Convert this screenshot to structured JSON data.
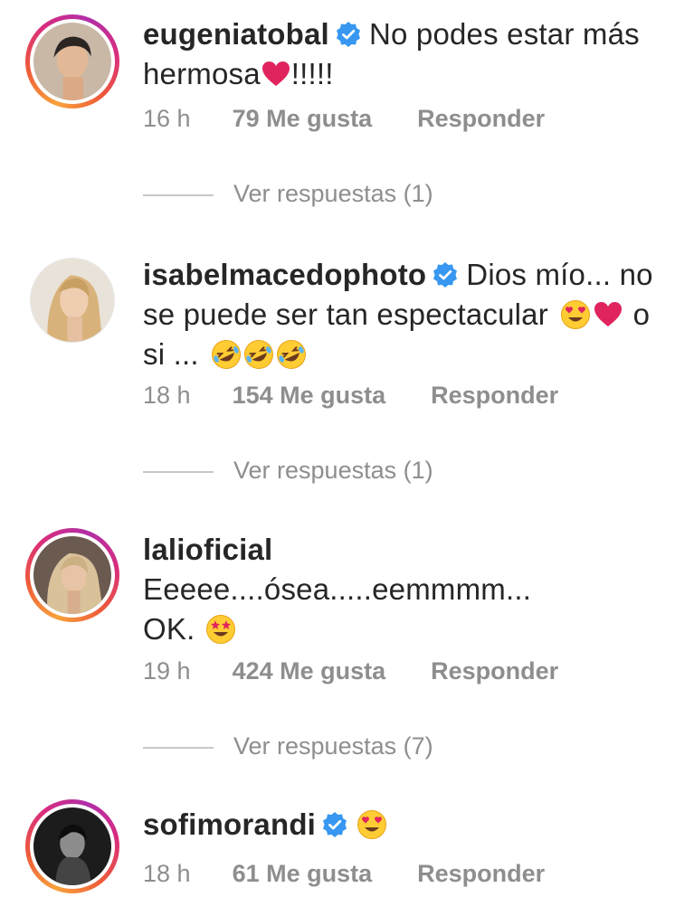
{
  "comments": [
    {
      "username": "eugeniatobal",
      "verified": true,
      "text_lines": [
        "No podes estar más",
        "hermosa",
        "!!!!!"
      ],
      "time": "16 h",
      "likes": "79 Me gusta",
      "reply": "Responder",
      "view_replies": "Ver respuestas (1)",
      "avatar_ring": "story"
    },
    {
      "username": "isabelmacedophoto",
      "verified": true,
      "text_lines": [
        "Dios mío... no",
        "se puede ser tan espectacular",
        "o",
        "si ..."
      ],
      "time": "18 h",
      "likes": "154 Me gusta",
      "reply": "Responder",
      "view_replies": "Ver respuestas (1)",
      "avatar_ring": "none"
    },
    {
      "username": "lalioficial",
      "verified": false,
      "text_lines": [
        "Eeeee....ósea.....eemmmm...",
        "OK."
      ],
      "time": "19 h",
      "likes": "424 Me gusta",
      "reply": "Responder",
      "view_replies": "Ver respuestas (7)",
      "avatar_ring": "story"
    },
    {
      "username": "sofimorandi",
      "verified": true,
      "text_lines": [],
      "time": "18 h",
      "likes": "61 Me gusta",
      "reply": "Responder",
      "avatar_ring": "story"
    }
  ],
  "colors": {
    "verified_badge": "#3897f0",
    "meta_text": "#8e8e8e",
    "heart": "#e0245e"
  }
}
